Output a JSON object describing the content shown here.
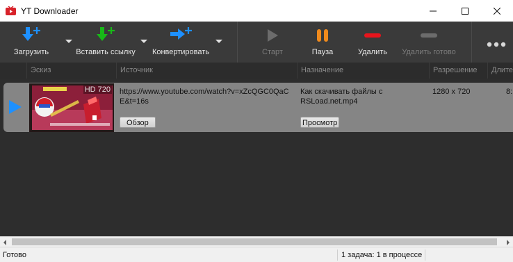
{
  "window": {
    "title": "YT Downloader",
    "minimize_icon": "minimize-icon",
    "maximize_icon": "maximize-icon",
    "close_icon": "close-icon"
  },
  "toolbar": {
    "download_label": "Загрузить",
    "paste_link_label": "Вставить ссылку",
    "convert_label": "Конвертировать",
    "start_label": "Старт",
    "pause_label": "Пауза",
    "delete_label": "Удалить",
    "delete_done_label": "Удалить готово",
    "more_icon": "more-dots-icon",
    "colors": {
      "download": "#1e90ff",
      "paste": "#18b818",
      "convert": "#1e90ff",
      "pause": "#f08a1c",
      "delete": "#e8141c",
      "disabled": "#6c6c6c"
    }
  },
  "columns": [
    "Эскиз",
    "Источник",
    "Назначение",
    "Разрешение",
    "Длите"
  ],
  "rows": [
    {
      "thumbnail_badge": "HD 720",
      "source_url_line1": "https://www.youtube.com/watch?v=xZcQGC0QaC",
      "source_url_line2": "E&t=16s",
      "browse_label": "Обзор",
      "destination_line1": "Как скачивать файлы с",
      "destination_line2": "RSLoad.net.mp4",
      "view_label": "Просмотр",
      "resolution": "1280 x 720",
      "duration": "8:"
    }
  ],
  "status": {
    "left": "Готово",
    "tasks": "1 задача: 1 в процессе"
  }
}
